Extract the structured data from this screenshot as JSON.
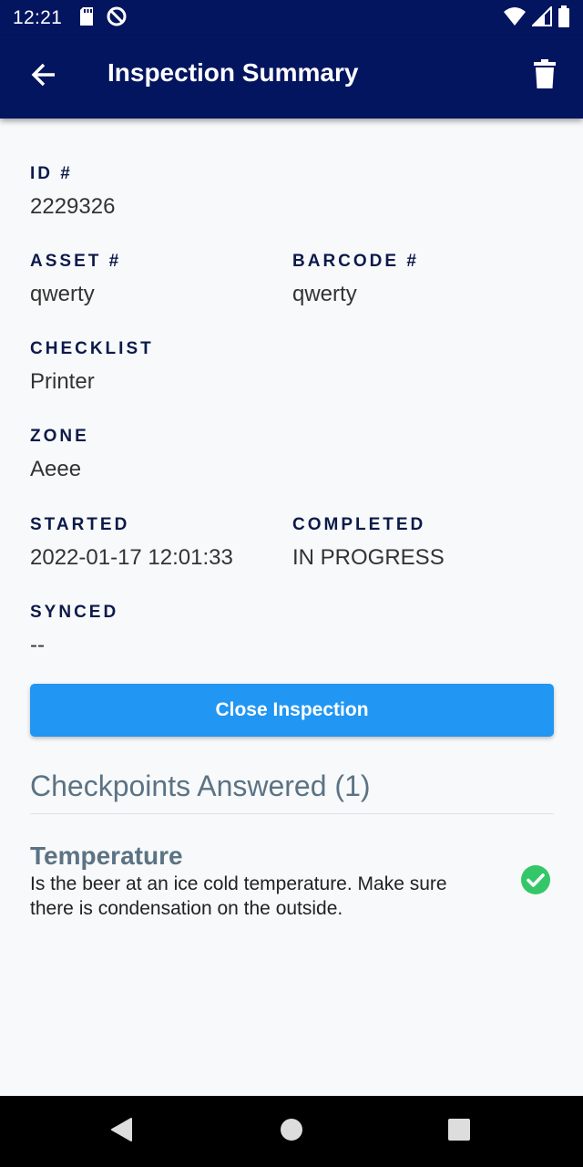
{
  "status_bar": {
    "time": "12:21"
  },
  "app_bar": {
    "title": "Inspection Summary",
    "back_icon": "arrow-left-icon",
    "delete_icon": "trash-icon"
  },
  "fields": {
    "id": {
      "label": "ID #",
      "value": "2229326"
    },
    "asset": {
      "label": "ASSET #",
      "value": "qwerty"
    },
    "barcode": {
      "label": "BARCODE #",
      "value": "qwerty"
    },
    "checklist": {
      "label": "CHECKLIST",
      "value": "Printer"
    },
    "zone": {
      "label": "ZONE",
      "value": "Aeee"
    },
    "started": {
      "label": "STARTED",
      "value": "2022-01-17 12:01:33"
    },
    "completed": {
      "label": "COMPLETED",
      "value": "IN PROGRESS"
    },
    "synced": {
      "label": "SYNCED",
      "value": "--"
    }
  },
  "actions": {
    "close_label": "Close Inspection"
  },
  "checkpoints": {
    "title": "Checkpoints Answered (1)",
    "items": [
      {
        "title": "Temperature",
        "description": "Is the beer at an ice cold temperature. Make sure there is condensation on the outside.",
        "status_icon": "check-circle-icon"
      }
    ]
  },
  "colors": {
    "app_bar": "#041560",
    "primary_button": "#2196f3",
    "label": "#0c1a4a",
    "section_title": "#5b7384",
    "success": "#34c768"
  }
}
